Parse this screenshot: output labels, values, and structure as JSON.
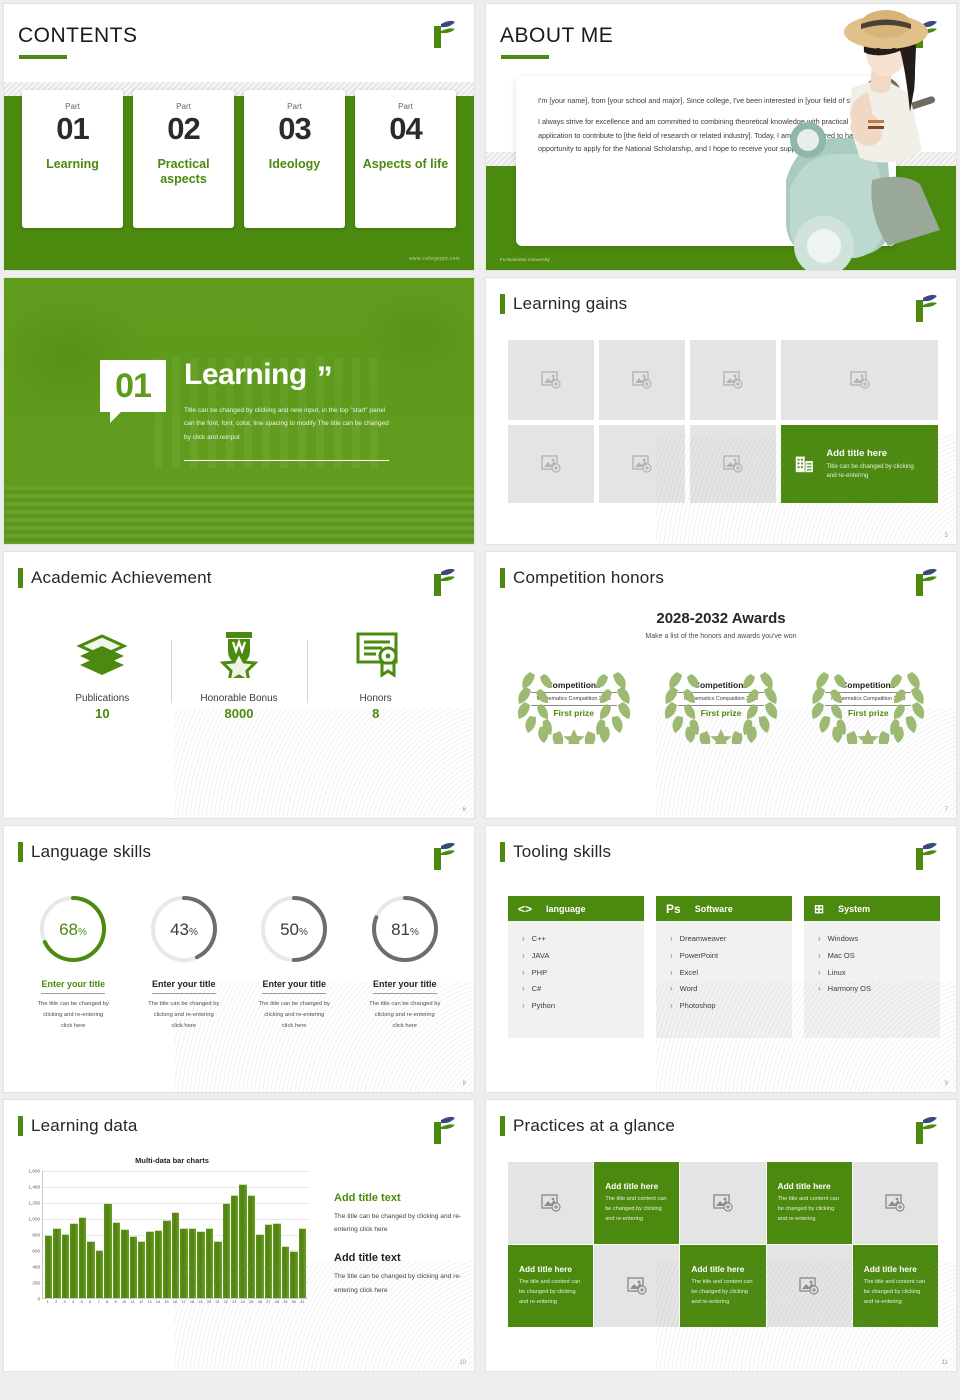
{
  "brand": {
    "green": "#4b8a0f",
    "gray": "#e4e4e4",
    "logo_name": "leaf-f-logo"
  },
  "slide1": {
    "title": "CONTENTS",
    "parts": [
      {
        "label": "Part",
        "num": "01",
        "name": "Learning"
      },
      {
        "label": "Part",
        "num": "02",
        "name": "Practical\naspects"
      },
      {
        "label": "Part",
        "num": "03",
        "name": "Ideology"
      },
      {
        "label": "Part",
        "num": "04",
        "name": "Aspects\nof life"
      }
    ],
    "footer": "www.collegeppt.com"
  },
  "slide2": {
    "title": "ABOUT ME",
    "paragraphs": [
      "I'm [your name], from [your school and major]. Since college, I've been interested in [your field of study].",
      "I always strive for excellence and am committed to combining theoretical knowledge with practical application to contribute to [the field of research or related industry]. Today, I am very honored to have the opportunity to apply for the National Scholarship, and I hope to receive your support and recognition."
    ],
    "footer": "Fu-business University",
    "photo_alt": "girl-on-scooter-photo"
  },
  "slide3": {
    "number": "01",
    "heading": "Learning",
    "quote_glyph": "”",
    "body": "Title can be changed by clicking and new input, in the top \"start\" panel can the font, font, color, line spacing to modify The title can be changed by click and reinput"
  },
  "slide4": {
    "title": "Learning gains",
    "page": "5",
    "placeholders": 7,
    "highlight": {
      "heading": "Add title here",
      "body": "Title can be changed by clicking and re-entering",
      "icon": "building-icon"
    }
  },
  "slide5": {
    "title": "Academic Achievement",
    "page": "6",
    "stats": [
      {
        "icon": "books-icon",
        "label": "Publications",
        "value": "10"
      },
      {
        "icon": "medal-icon",
        "label": "Honorable Bonus",
        "value": "8000"
      },
      {
        "icon": "certificate-icon",
        "label": "Honors",
        "value": "8"
      }
    ]
  },
  "slide6": {
    "title": "Competition honors",
    "page": "7",
    "awards_title": "2028-2032 Awards",
    "awards_sub": "Make a list of the honors and awards you've won",
    "wreaths": [
      {
        "ctitle": "Competitions",
        "cdesc": "Mathematics Compatition\n2028",
        "prize": "First prize"
      },
      {
        "ctitle": "Competitions",
        "cdesc": "Mathematics Compatition\n2028",
        "prize": "First prize"
      },
      {
        "ctitle": "Competitions",
        "cdesc": "Mathematics Compatition\n2028",
        "prize": "First prize"
      }
    ]
  },
  "slide7": {
    "title": "Language skills",
    "page": "8",
    "rings": [
      {
        "pct": "68",
        "unit": "%",
        "title": "Enter your title",
        "desc": "The title can be changed by clicking and re-entering click here",
        "accent": true
      },
      {
        "pct": "43",
        "unit": "%",
        "title": "Enter your title",
        "desc": "The title can be changed by clicking and re-entering click here",
        "accent": false
      },
      {
        "pct": "50",
        "unit": "%",
        "title": "Enter your title",
        "desc": "The title can be changed by clicking and re-entering click here",
        "accent": false
      },
      {
        "pct": "81",
        "unit": "%",
        "title": "Enter your title",
        "desc": "The title can be changed by clicking and re-entering click here",
        "accent": false
      }
    ]
  },
  "slide8": {
    "title": "Tooling skills",
    "page": "9",
    "cards": [
      {
        "icon": "code-brackets-icon",
        "icon_text": "<>",
        "name": "language",
        "items": [
          "C++",
          "JAVA",
          "PHP",
          "C#",
          "Python"
        ]
      },
      {
        "icon": "photoshop-icon",
        "icon_text": "Ps",
        "name": "Software",
        "items": [
          "Dreamweaver",
          "PowerPoint",
          "Excel",
          "Word",
          "Photoshop"
        ]
      },
      {
        "icon": "windows-icon",
        "icon_text": "⊞",
        "name": "System",
        "items": [
          "Windows",
          "Mac OS",
          "Linux",
          "Harmony OS"
        ]
      }
    ]
  },
  "slide9": {
    "title": "Learning data",
    "page": "10",
    "blocks": [
      {
        "heading": "Add title text",
        "body": "The title can be changed by clicking and re-entering click here",
        "accent": true
      },
      {
        "heading": "Add title text",
        "body": "The title can be changed by clicking and re-entering click here",
        "accent": false
      }
    ]
  },
  "chart_data": {
    "type": "bar",
    "title": "Multi-data bar charts",
    "xlabel": "",
    "ylabel": "",
    "ylim": [
      0,
      1600
    ],
    "yticks": [
      0,
      200,
      400,
      600,
      800,
      1000,
      1200,
      1400,
      1600
    ],
    "ytick_labels": [
      "0",
      "200",
      "400",
      "600",
      "800",
      "1,000",
      "1,200",
      "1,400",
      "1,600"
    ],
    "grid": true,
    "legend": "none",
    "categories": [
      "1",
      "2",
      "3",
      "4",
      "5",
      "6",
      "7",
      "8",
      "9",
      "10",
      "11",
      "12",
      "13",
      "14",
      "15",
      "16",
      "17",
      "18",
      "19",
      "20",
      "21",
      "22",
      "23",
      "24",
      "25",
      "26",
      "27",
      "28",
      "29",
      "30",
      "31"
    ],
    "values": [
      790,
      880,
      805,
      940,
      1020,
      720,
      600,
      1200,
      960,
      870,
      775,
      720,
      850,
      855,
      980,
      1080,
      880,
      880,
      845,
      880,
      720,
      1200,
      1300,
      1440,
      1300,
      805,
      930,
      940,
      650,
      590,
      880
    ]
  },
  "slide10": {
    "title": "Practices at a glance",
    "page": "11",
    "cells": [
      {
        "type": "image",
        "icon": "image-placeholder-icon"
      },
      {
        "type": "text",
        "heading": "Add title here",
        "body": "The title and content can be changed by clicking and re-entering"
      },
      {
        "type": "image",
        "icon": "image-placeholder-icon"
      },
      {
        "type": "text",
        "heading": "Add title here",
        "body": "The title and content can be changed by clicking and re-entering"
      },
      {
        "type": "image",
        "icon": "image-placeholder-icon"
      },
      {
        "type": "text",
        "heading": "Add title here",
        "body": "The title and content can be changed by clicking and re-entering"
      },
      {
        "type": "image",
        "icon": "image-placeholder-icon"
      },
      {
        "type": "text",
        "heading": "Add title here",
        "body": "The title and content can be changed by clicking and re-entering"
      },
      {
        "type": "image",
        "icon": "image-placeholder-icon"
      },
      {
        "type": "text",
        "heading": "Add title here",
        "body": "The title and content can be changed by clicking and re-entering"
      }
    ]
  }
}
